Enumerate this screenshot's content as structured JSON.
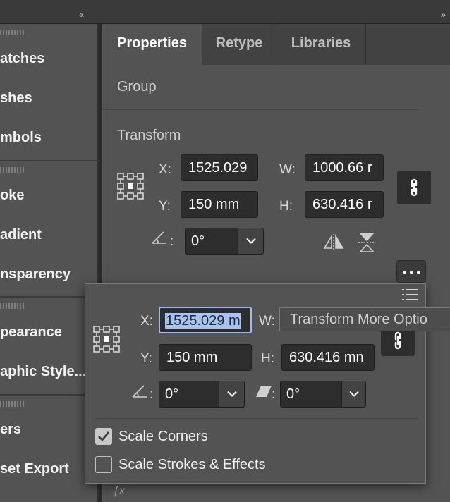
{
  "topbar": {
    "collapse_left": "‹‹",
    "collapse_right": "››"
  },
  "left_panel": {
    "items": [
      "atches",
      "shes",
      "mbols",
      "oke",
      "adient",
      "nsparency",
      "pearance",
      "aphic Style...",
      "ers",
      "set Export"
    ]
  },
  "tabs": [
    "Properties",
    "Retype",
    "Libraries"
  ],
  "properties": {
    "group_label": "Group",
    "transform_label": "Transform",
    "x_label": "X:",
    "x_value": "1525.029",
    "y_label": "Y:",
    "y_value": "150 mm",
    "w_label": "W:",
    "w_value": "1000.66 r",
    "h_label": "H:",
    "h_value": "630.416 r",
    "angle_label": ":",
    "angle_value": "0°"
  },
  "popup": {
    "x_label": "X:",
    "x_value": "1525.029 m",
    "w_label": "W:",
    "y_label": "Y:",
    "y_value": "150 mm",
    "h_label": "H:",
    "h_value": "630.416 mn",
    "rotate_label": ":",
    "rotate_value": "0°",
    "shear_label": ":",
    "shear_value": "0°",
    "scale_corners": {
      "label": "Scale Corners",
      "checked": true
    },
    "scale_strokes": {
      "label": "Scale Strokes & Effects",
      "checked": false
    }
  },
  "tooltip": "Transform More Optio",
  "colors": {
    "panel_bg": "#535353",
    "tab_bar": "#424242",
    "field_bg": "#2d2d2d",
    "selection": "#a7c3ee"
  }
}
